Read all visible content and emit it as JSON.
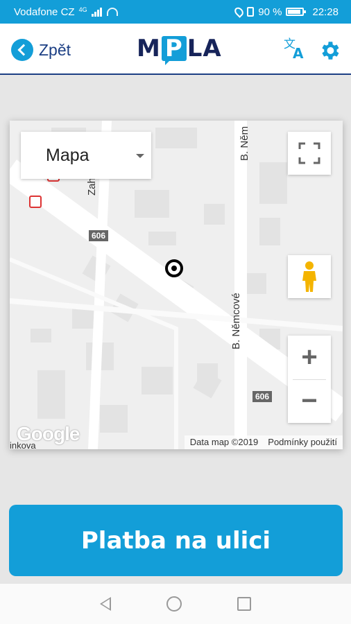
{
  "status_bar": {
    "carrier": "Vodafone CZ",
    "network": "4G",
    "battery_percent": "90 %",
    "battery_level": 0.9,
    "time": "22:28"
  },
  "header": {
    "back_label": "Zpět",
    "logo_text": [
      "M",
      "P",
      "LA"
    ],
    "icons": [
      "translate-icon",
      "gear-icon"
    ]
  },
  "map": {
    "type_selector": "Mapa",
    "streets": [
      "Zahrad",
      "B. Něm",
      "B. Němcové"
    ],
    "road_numbers": [
      "606",
      "606"
    ],
    "google_logo": "Google",
    "street_fragment": "inkova",
    "attribution": "Data map ©2019",
    "terms": "Podmínky použití",
    "zoom_in": "+",
    "zoom_out": "−"
  },
  "main": {
    "pay_button": "Platba na ulici"
  },
  "colors": {
    "accent": "#139ed8",
    "brand_dark": "#1c3f84"
  }
}
